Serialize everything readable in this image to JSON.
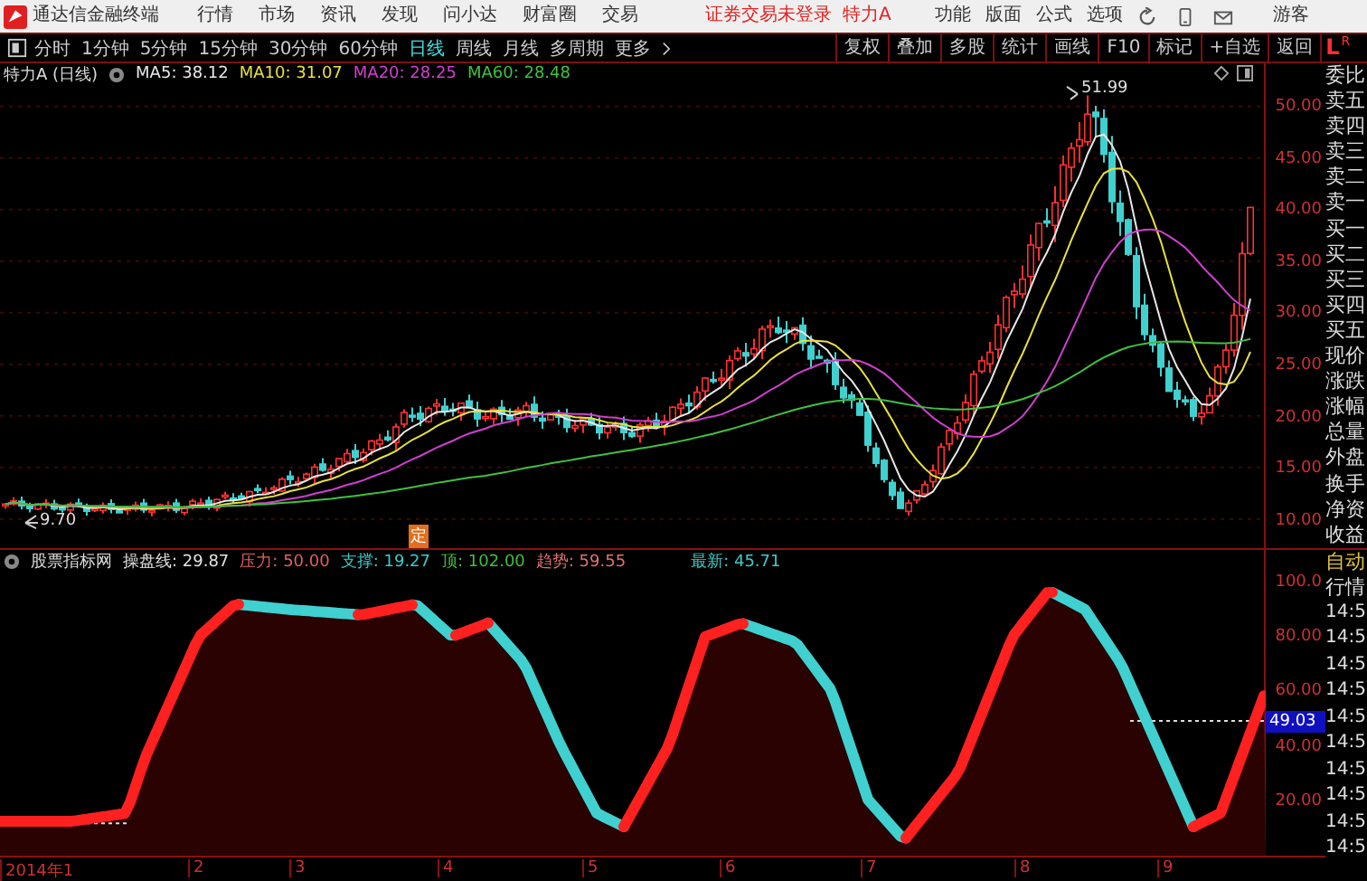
{
  "menubar": {
    "app_title": "通达信金融终端",
    "menus": [
      "行情",
      "市场",
      "资讯",
      "发现",
      "问小达",
      "财富圈",
      "交易"
    ],
    "status": "证券交易未登录",
    "stock": "特力A",
    "right_menus": [
      "功能",
      "版面",
      "公式",
      "选项"
    ],
    "user": "游客"
  },
  "toolbar": {
    "periods": [
      {
        "label": "分时",
        "selected": false
      },
      {
        "label": "1分钟",
        "selected": false
      },
      {
        "label": "5分钟",
        "selected": false
      },
      {
        "label": "15分钟",
        "selected": false
      },
      {
        "label": "30分钟",
        "selected": false
      },
      {
        "label": "60分钟",
        "selected": false
      },
      {
        "label": "日线",
        "selected": true
      },
      {
        "label": "周线",
        "selected": false
      },
      {
        "label": "月线",
        "selected": false
      },
      {
        "label": "多周期",
        "selected": false
      }
    ],
    "more": "更多",
    "tools": [
      "复权",
      "叠加",
      "多股",
      "统计",
      "画线",
      "F10",
      "标记",
      "+自选",
      "返回"
    ],
    "badge_letter": "L",
    "badge_sub": "R"
  },
  "price_chart": {
    "title": "特力A (日线)",
    "moving_averages": [
      {
        "label": "MA5:",
        "value": "38.12",
        "color": "#e8e8e8"
      },
      {
        "label": "MA10:",
        "value": "31.07",
        "color": "#e8e040"
      },
      {
        "label": "MA20:",
        "value": "28.25",
        "color": "#d040d0"
      },
      {
        "label": "MA60:",
        "value": "28.48",
        "color": "#40c040"
      }
    ],
    "high_label": "51.99",
    "low_label": "9.70",
    "marker": "定",
    "axis_labels": [
      "50.00",
      "45.00",
      "40.00",
      "35.00",
      "30.00",
      "25.00",
      "20.00",
      "15.00",
      "10.00"
    ]
  },
  "indicator": {
    "name": "股票指标网",
    "fields": [
      {
        "label": "操盘线:",
        "value": "29.87",
        "color": "#e0e0e0"
      },
      {
        "label": "压力:",
        "value": "50.00",
        "color": "#e06060"
      },
      {
        "label": "支撑:",
        "value": "19.27",
        "color": "#40c8c8"
      },
      {
        "label": "顶:",
        "value": "102.00",
        "color": "#40c040"
      },
      {
        "label": "趋势:",
        "value": "59.55",
        "color": "#e07070"
      }
    ],
    "latest_label": "最新:",
    "latest_value": "45.71",
    "axis_labels": [
      "100.0",
      "80.00",
      "60.00",
      "40.00",
      "20.00"
    ],
    "current_value": "49.03"
  },
  "x_axis": [
    "2014年1",
    "2",
    "3",
    "4",
    "5",
    "6",
    "7",
    "8",
    "9"
  ],
  "side_panel": {
    "quote_labels": [
      "委比",
      "卖五",
      "卖四",
      "卖三",
      "卖二",
      "卖一",
      "买一",
      "买二",
      "买三",
      "买四",
      "买五",
      "现价",
      "涨跌",
      "涨幅",
      "总量",
      "外盘",
      "换手",
      "净资",
      "收益"
    ],
    "mode": "自动",
    "section": "行情",
    "times": [
      "14:5",
      "14:5",
      "14:5",
      "14:5",
      "14:5",
      "14:5",
      "14:5",
      "14:5",
      "14:5",
      "14:5"
    ]
  }
}
